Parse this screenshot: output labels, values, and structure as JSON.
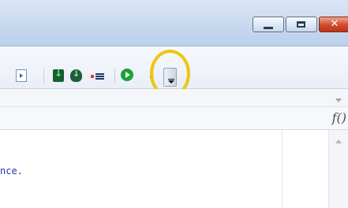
{
  "window": {
    "minimize_label": "",
    "maximize_label": "",
    "close_label": "✕"
  },
  "toolbar": {
    "buttons": [
      {
        "icon": "page-play-icon"
      },
      {
        "icon": "download-green-icon"
      },
      {
        "icon": "download-shield-icon"
      },
      {
        "icon": "list-icon"
      },
      {
        "icon": "run-icon"
      },
      {
        "icon": "step-icon"
      },
      {
        "icon": "toolbar-options-icon"
      }
    ]
  },
  "formula_bar": {
    "fx_label": "f()"
  },
  "editor": {
    "code_fragment": "nce."
  },
  "colors": {
    "highlight": "#f1c40f",
    "code_text": "#2233b8"
  }
}
